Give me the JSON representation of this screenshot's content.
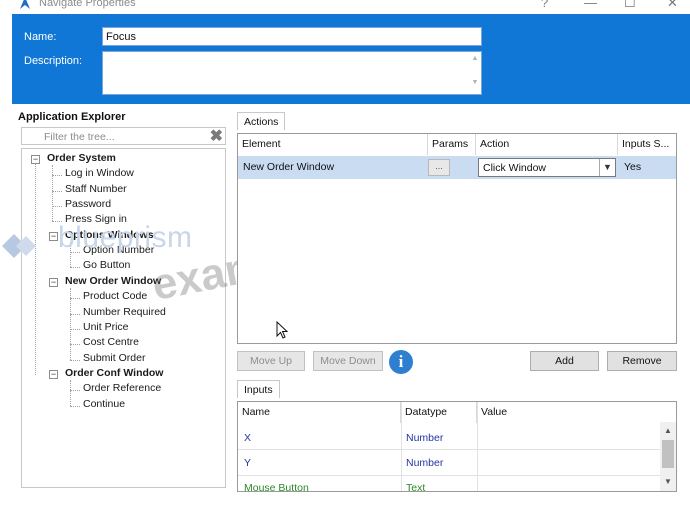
{
  "window": {
    "title": "Navigate Properties",
    "help_glyph": "?",
    "minimize_glyph": "—",
    "maximize_glyph": "☐",
    "close_glyph": "✕"
  },
  "header": {
    "name_label": "Name:",
    "name_value": "Focus",
    "description_label": "Description:",
    "description_value": ""
  },
  "explorer": {
    "title": "Application Explorer",
    "filter_placeholder": "Filter the tree...",
    "clear_glyph": "✖",
    "tree": [
      {
        "label": "Order System",
        "bold": true,
        "expander": "−"
      },
      {
        "label": "Log in Window",
        "bold": false
      },
      {
        "label": "Staff Number",
        "bold": false
      },
      {
        "label": "Password",
        "bold": false
      },
      {
        "label": "Press Sign in",
        "bold": false
      },
      {
        "label": "Options Windows",
        "bold": true,
        "expander": "−"
      },
      {
        "label": "Option Number",
        "bold": false
      },
      {
        "label": "Go Button",
        "bold": false
      },
      {
        "label": "New Order Window",
        "bold": true,
        "expander": "−"
      },
      {
        "label": "Product Code",
        "bold": false
      },
      {
        "label": "Number Required",
        "bold": false
      },
      {
        "label": "Unit Price",
        "bold": false
      },
      {
        "label": "Cost Centre",
        "bold": false
      },
      {
        "label": "Submit Order",
        "bold": false
      },
      {
        "label": "Order Conf Window",
        "bold": true,
        "expander": "−"
      },
      {
        "label": "Order Reference",
        "bold": false
      },
      {
        "label": "Continue",
        "bold": false
      }
    ]
  },
  "actions": {
    "tab_label": "Actions",
    "columns": [
      "Element",
      "Params",
      "Action",
      "Inputs S..."
    ],
    "row": {
      "element": "New Order Window",
      "params_glyph": "...",
      "action": "Click Window",
      "inputs": "Yes"
    },
    "move_up_label": "Move Up",
    "move_down_label": "Move Down",
    "info_glyph": "i",
    "add_label": "Add",
    "remove_label": "Remove"
  },
  "inputs": {
    "tab_label": "Inputs",
    "columns": [
      "Name",
      "Datatype",
      "Value"
    ],
    "rows": [
      {
        "name": "X",
        "datatype": "Number",
        "value": ""
      },
      {
        "name": "Y",
        "datatype": "Number",
        "value": ""
      },
      {
        "name": "Mouse Button",
        "datatype": "Text",
        "value": ""
      }
    ]
  },
  "watermark": {
    "brand": "blueprism",
    "site": "exam-tests.com"
  },
  "colors": {
    "header_blue": "#1177d6",
    "selected_row": "#c9dcf1",
    "input_name_blue": "#2535a0",
    "input_name_green": "#2a8a2a"
  }
}
